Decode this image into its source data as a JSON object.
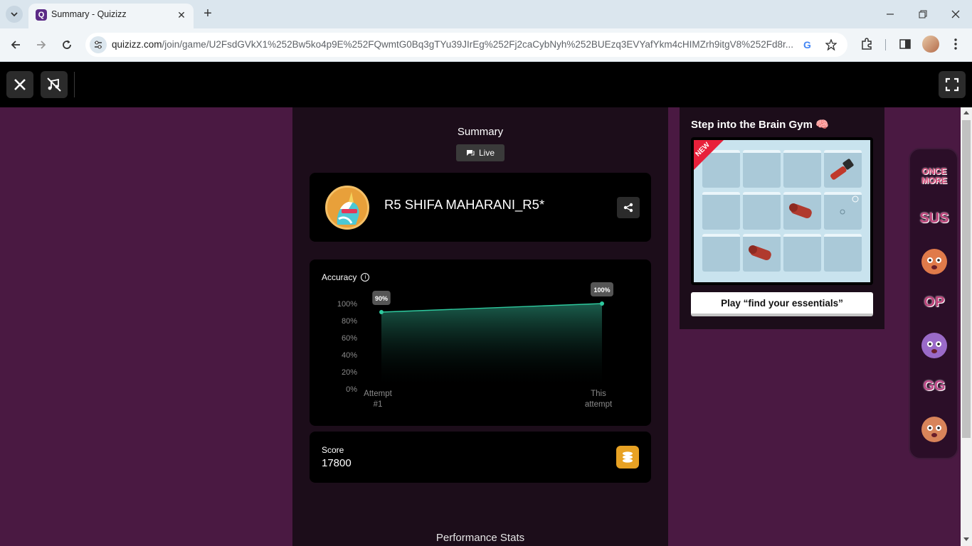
{
  "browser": {
    "tab_title": "Summary - Quizizz",
    "url_host": "quizizz.com",
    "url_path": "/join/game/U2FsdGVkX1%252Bw5ko4p9E%252FQwmtG0Bq3gTYu39JIrEg%252Fj2caCybNyh%252BUEzq3EVYafYkm4cHIMZrh9itgV8%252Fd8r..."
  },
  "summary": {
    "title": "Summary",
    "mode_label": "Live"
  },
  "player": {
    "name": "R5 SHIFA MAHARANI_R5*"
  },
  "accuracy": {
    "title": "Accuracy"
  },
  "chart_data": {
    "type": "area",
    "categories": [
      "Attempt #1",
      "This attempt"
    ],
    "category_lines": [
      [
        "Attempt",
        "#1"
      ],
      [
        "This",
        "attempt"
      ]
    ],
    "values": [
      90,
      100
    ],
    "value_labels": [
      "90%",
      "100%"
    ],
    "y_ticks": [
      "100%",
      "80%",
      "60%",
      "40%",
      "20%",
      "0%"
    ],
    "ylim": [
      0,
      100
    ],
    "colors": {
      "line": "#2ec99e",
      "fill": "#1f6e5a"
    }
  },
  "score": {
    "label": "Score",
    "value": "17800"
  },
  "performance": {
    "title": "Performance Stats"
  },
  "brain_gym": {
    "title": "Step into the Brain Gym 🧠",
    "badge": "NEW",
    "play_label": "Play “find your essentials”"
  },
  "stickers": [
    {
      "name": "once-more-sticker",
      "text": "ONCE MORE",
      "color": "#d84a7a"
    },
    {
      "name": "sus-sticker",
      "text": "SUS",
      "color": "#c0447c"
    },
    {
      "name": "shocked-face-sticker",
      "text": "",
      "color": "#e07a4a"
    },
    {
      "name": "op-sticker",
      "text": "OP",
      "color": "#c0447c"
    },
    {
      "name": "crewmate-sticker",
      "text": "",
      "color": "#9a6ac8"
    },
    {
      "name": "gg-sticker",
      "text": "GG",
      "color": "#c04a8a"
    },
    {
      "name": "face-sticker",
      "text": "",
      "color": "#d8845a"
    }
  ]
}
